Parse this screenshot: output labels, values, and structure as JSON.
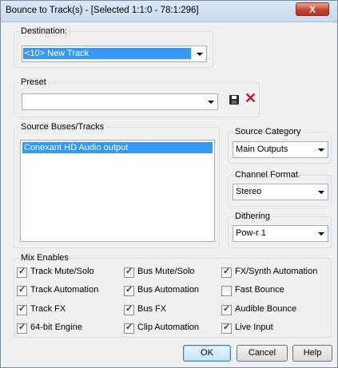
{
  "window": {
    "title": "Bounce to Track(s) - [Selected 1:1:0 - 78:1:296]",
    "close_glyph": "X"
  },
  "destination": {
    "label": "Destination:",
    "value": "<10> New Track"
  },
  "preset": {
    "label": "Preset",
    "value": ""
  },
  "source_tracks": {
    "label": "Source Buses/Tracks",
    "items": [
      "Conexant HD Audio output"
    ]
  },
  "source_category": {
    "label": "Source Category",
    "value": "Main Outputs"
  },
  "channel_format": {
    "label": "Channel Format",
    "value": "Stereo"
  },
  "dithering": {
    "label": "Dithering",
    "value": "Pow-r 1"
  },
  "mix_enables": {
    "label": "Mix Enables",
    "options": [
      {
        "label": "Track Mute/Solo",
        "checked": true
      },
      {
        "label": "Bus Mute/Solo",
        "checked": true
      },
      {
        "label": "FX/Synth Automation",
        "checked": true
      },
      {
        "label": "Track Automation",
        "checked": true
      },
      {
        "label": "Bus Automation",
        "checked": true
      },
      {
        "label": "Fast Bounce",
        "checked": false
      },
      {
        "label": "Track FX",
        "checked": true
      },
      {
        "label": "Bus FX",
        "checked": true
      },
      {
        "label": "Audible Bounce",
        "checked": true
      },
      {
        "label": "64-bit Engine",
        "checked": true
      },
      {
        "label": "Clip Automation",
        "checked": true
      },
      {
        "label": "Live Input",
        "checked": true
      }
    ]
  },
  "buttons": {
    "ok": "OK",
    "cancel": "Cancel",
    "help": "Help"
  },
  "icons": {
    "save": "save-icon",
    "delete": "delete-icon"
  },
  "colors": {
    "selection": "#3399ff",
    "delete": "#d2141a"
  }
}
